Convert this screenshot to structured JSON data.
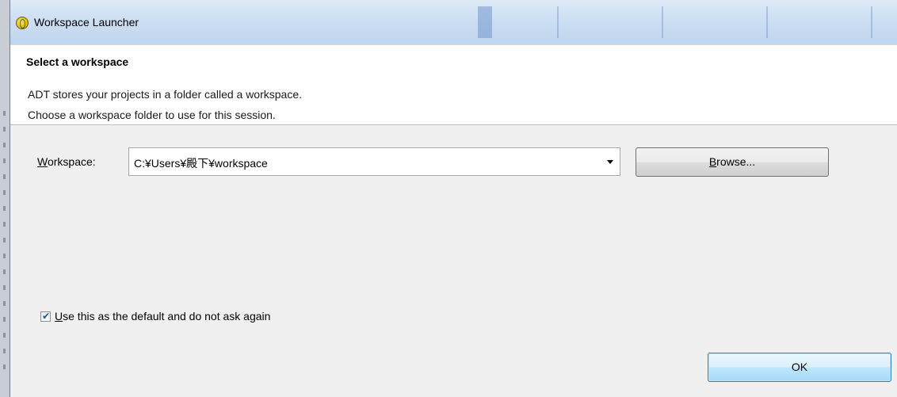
{
  "window": {
    "title": "Workspace Launcher",
    "icon": "eclipse-icon"
  },
  "header": {
    "title": "Select a workspace",
    "line1": "ADT stores your projects in a folder called a workspace.",
    "line2": "Choose a workspace folder to use for this session."
  },
  "workspace": {
    "label_mnemonic": "W",
    "label_rest": "orkspace:",
    "value": "C:¥Users¥殿下¥workspace",
    "dropdown_icon": "chevron-down-icon"
  },
  "browse_button": {
    "mnemonic": "B",
    "rest": "rowse..."
  },
  "default_checkbox": {
    "checked": true,
    "mark": "✔",
    "label_mnemonic": "U",
    "label_rest": "se this as the default and do not ask again"
  },
  "ok_button": {
    "label": "OK"
  }
}
